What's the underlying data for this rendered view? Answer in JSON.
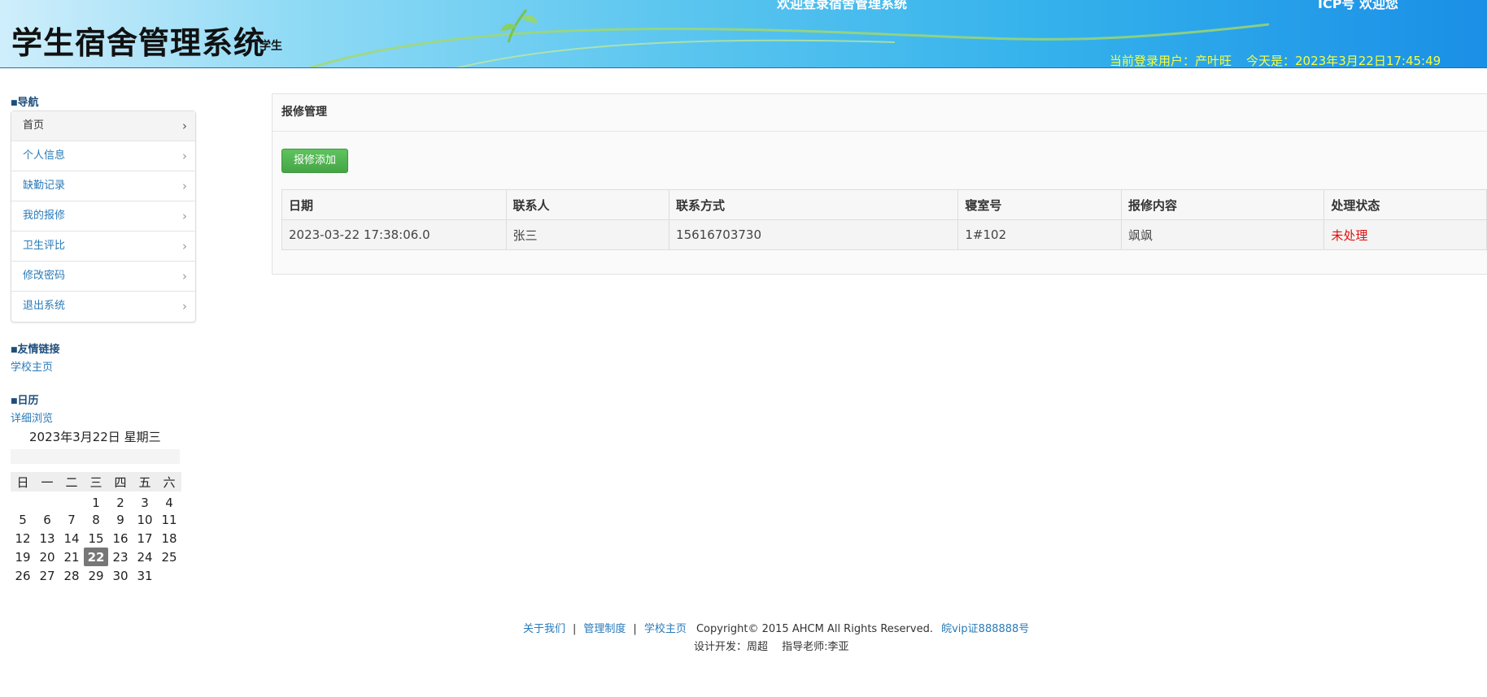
{
  "header": {
    "top_left_text": "欢迎登录宿舍管理系统",
    "top_right_text": "ICP号 欢迎您",
    "title": "学生宿舍管理系统",
    "role": "学生",
    "user_label": "当前登录用户：产叶旺",
    "date_label": "今天是：2023年3月22日17:45:49"
  },
  "sidebar": {
    "nav_title": "导航",
    "nav_items": [
      {
        "label": "首页"
      },
      {
        "label": "个人信息"
      },
      {
        "label": "缺勤记录"
      },
      {
        "label": "我的报修"
      },
      {
        "label": "卫生评比"
      },
      {
        "label": "修改密码"
      },
      {
        "label": "退出系统"
      }
    ],
    "links_title": "友情链接",
    "links": [
      {
        "label": "学校主页"
      }
    ],
    "calendar_title": "日历",
    "calendar_detail": "详细浏览",
    "calendar_date": "2023年3月22日 星期三",
    "weekdays": [
      "日",
      "一",
      "二",
      "三",
      "四",
      "五",
      "六"
    ],
    "weeks": [
      [
        "",
        "",
        "",
        "1",
        "2",
        "3",
        "4"
      ],
      [
        "5",
        "6",
        "7",
        "8",
        "9",
        "10",
        "11"
      ],
      [
        "12",
        "13",
        "14",
        "15",
        "16",
        "17",
        "18"
      ],
      [
        "19",
        "20",
        "21",
        "22",
        "23",
        "24",
        "25"
      ],
      [
        "26",
        "27",
        "28",
        "29",
        "30",
        "31",
        ""
      ]
    ],
    "today": "22"
  },
  "main": {
    "panel_title": "报修管理",
    "add_button": "报修添加",
    "columns": [
      "日期",
      "联系人",
      "联系方式",
      "寝室号",
      "报修内容",
      "处理状态"
    ],
    "rows": [
      [
        "2023-03-22 17:38:06.0",
        "张三",
        "15616703730",
        "1#102",
        "飒飒",
        "未处理"
      ]
    ]
  },
  "footer": {
    "about": "关于我们",
    "rules": "管理制度",
    "school": "学校主页",
    "copyright": "Copyright© 2015 AHCM All Rights Reserved.",
    "icp": "皖vip证888888号",
    "credits": "设计开发：周超　 指导老师:李亚"
  },
  "colors": {
    "header_start": "#cfeefb",
    "header_end": "#1a8fe6",
    "user_info": "#f6ff3b",
    "link": "#2a7ab8",
    "button_green": "#4cae4c",
    "status_red": "#d11111"
  }
}
